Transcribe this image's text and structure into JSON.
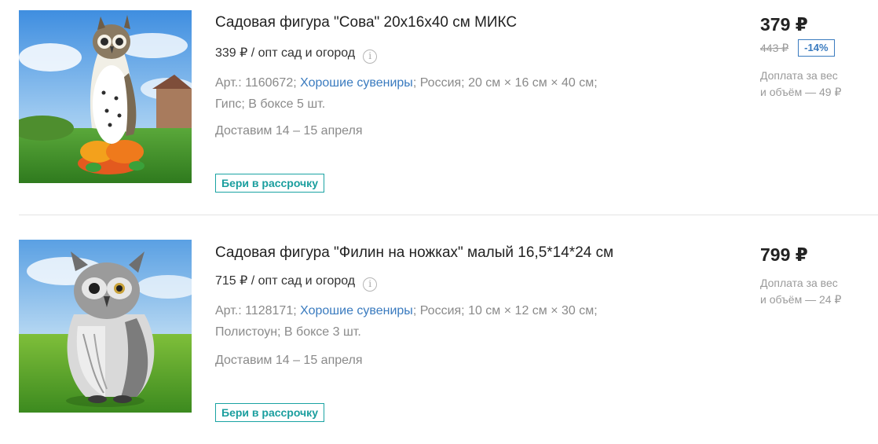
{
  "products": [
    {
      "title": "Садовая фигура \"Сова\" 20х16х40 см МИКС",
      "wholesale": "339 ₽ / опт сад и огород",
      "info_icon": "i",
      "specs": {
        "sku": "Арт.: 1160672",
        "brand": "Хорошие сувениры",
        "country": "Россия",
        "dimensions": "20 см × 16 см × 40 см",
        "material": "Гипс",
        "box_qty": "В боксе 5 шт."
      },
      "delivery": "Доставим 14 – 15 апреля",
      "installment": "Бери в рассрочку",
      "price": "379 ₽",
      "old_price": "443 ₽",
      "discount": "-14%",
      "surcharge_line1": "Доплата за вес",
      "surcharge_line2": "и объём — 49 ₽",
      "image_icon": "owl-figurine-colorful"
    },
    {
      "title": "Садовая фигура \"Филин на ножках\" малый 16,5*14*24 см",
      "wholesale": "715 ₽ / опт сад и огород",
      "info_icon": "i",
      "specs": {
        "sku": "Арт.: 1128171",
        "brand": "Хорошие сувениры",
        "country": "Россия",
        "dimensions": "10 см × 12 см × 30 см",
        "material": "Полистоун",
        "box_qty": "В боксе 3 шт."
      },
      "delivery": "Доставим 14 – 15 апреля",
      "installment": "Бери в рассрочку",
      "price": "799 ₽",
      "surcharge_line1": "Доплата за вес",
      "surcharge_line2": "и объём — 24 ₽",
      "image_icon": "owl-figurine-grey"
    }
  ],
  "colors": {
    "link": "#3a7bbf",
    "installment": "#1aa3a3",
    "muted": "#8a8a8a"
  }
}
